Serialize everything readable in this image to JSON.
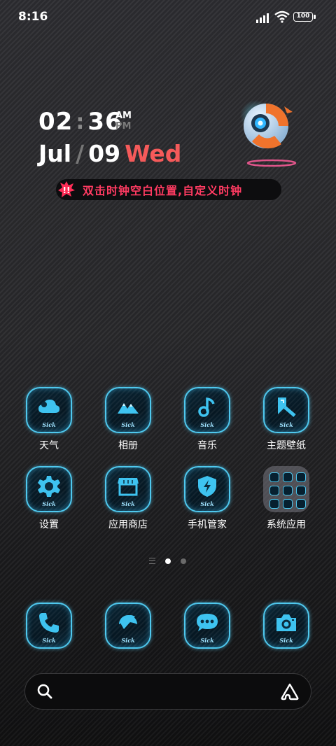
{
  "status": {
    "time": "8:16",
    "battery": "100"
  },
  "clock": {
    "hour": "02",
    "minute": "36",
    "am": "AM",
    "pm": "PM",
    "month": "Jul",
    "day": "09",
    "weekday": "Wed"
  },
  "banner": {
    "text": "双击时钟空白位置,自定义时钟"
  },
  "icon_badge": "Sick",
  "apps_row1": [
    {
      "label": "天气",
      "icon": "weather-cloud-icon"
    },
    {
      "label": "相册",
      "icon": "gallery-mountain-icon"
    },
    {
      "label": "音乐",
      "icon": "music-note-icon"
    },
    {
      "label": "主题壁纸",
      "icon": "theme-brush-icon"
    }
  ],
  "apps_row2": [
    {
      "label": "设置",
      "icon": "gear-icon"
    },
    {
      "label": "应用商店",
      "icon": "store-icon"
    },
    {
      "label": "手机管家",
      "icon": "security-shield-icon"
    },
    {
      "label": "系统应用",
      "icon": "folder-icon"
    }
  ],
  "dock": [
    {
      "icon": "phone-icon"
    },
    {
      "icon": "browser-icon"
    },
    {
      "icon": "messages-icon"
    },
    {
      "icon": "camera-icon"
    }
  ],
  "page_indicator": {
    "pages": 2,
    "current": 1
  },
  "colors": {
    "accent": "#4fc8ee",
    "weekday": "#f55a5a",
    "banner_text": "#ff3b62"
  }
}
